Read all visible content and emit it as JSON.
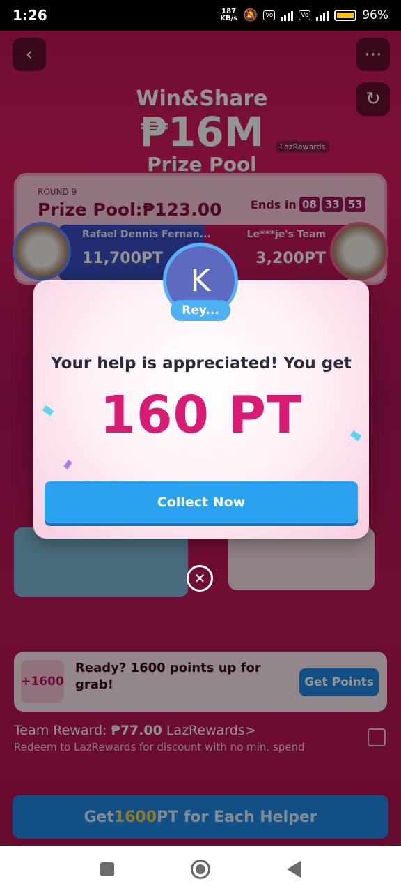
{
  "status_bar": {
    "time": "1:26",
    "net_speed": "187",
    "net_unit": "KB/s",
    "battery": "96%"
  },
  "hero": {
    "line1": "Win&Share",
    "line2": "₱16M",
    "line3": "Prize Pool",
    "badge": "LazRewards"
  },
  "round": {
    "label": "ROUND 9",
    "prize_pool": "Prize Pool:₱123.00",
    "ends_label": "Ends in",
    "timer": [
      "08",
      "33",
      "53"
    ]
  },
  "teams": {
    "left_name": "Rafael Dennis Fernan...",
    "left_points": "11,700PT",
    "right_name": "Le***je's Team",
    "right_points": "3,200PT"
  },
  "modal": {
    "avatar_letter": "K",
    "helper_name": "Rey...",
    "message": "Your help is appreciated! You get",
    "points": "160 PT",
    "collect_label": "Collect Now"
  },
  "promo": {
    "badge": "+1600",
    "text": "Ready? 1600 points up for grab!",
    "button": "Get Points"
  },
  "team_reward": {
    "label": "Team Reward:",
    "amount": "₱77.00",
    "link": "LazRewards>",
    "subtext": "Redeem to LazRewards for discount with no min. spend"
  },
  "cta": {
    "prefix": "Get ",
    "highlight": "1600",
    "suffix": " PT for Each Helper"
  },
  "colors": {
    "accent_pink": "#d81b73",
    "primary_blue": "#29a3f0"
  }
}
